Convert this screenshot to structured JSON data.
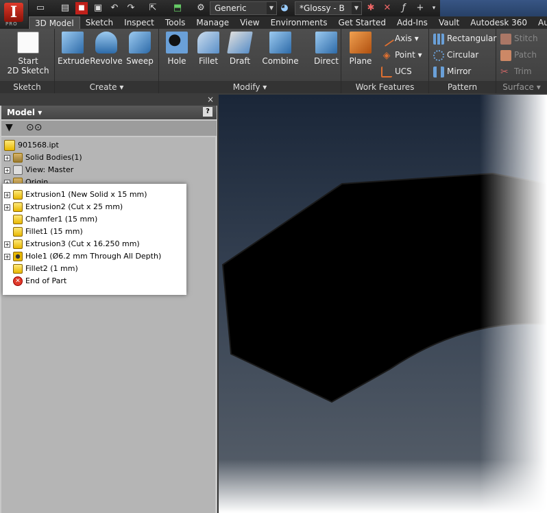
{
  "qat": {
    "material": "Generic",
    "appearance": "*Glossy - B"
  },
  "tabs": [
    "3D Model",
    "Sketch",
    "Inspect",
    "Tools",
    "Manage",
    "View",
    "Environments",
    "Get Started",
    "Add-Ins",
    "Vault",
    "Autodesk 360",
    "Autod"
  ],
  "ribbon": {
    "sketch": {
      "start_line1": "Start",
      "start_line2": "2D Sketch",
      "title": "Sketch"
    },
    "create": {
      "extrude": "Extrude",
      "revolve": "Revolve",
      "sweep": "Sweep",
      "title": "Create ▾"
    },
    "modify": {
      "hole": "Hole",
      "fillet": "Fillet",
      "draft": "Draft",
      "combine": "Combine",
      "direct": "Direct",
      "title": "Modify ▾"
    },
    "work": {
      "plane": "Plane",
      "axis": "Axis",
      "point": "Point",
      "ucs": "UCS",
      "title": "Work Features"
    },
    "pattern": {
      "rectangular": "Rectangular",
      "circular": "Circular",
      "mirror": "Mirror",
      "title": "Pattern"
    },
    "surface": {
      "stitch": "Stitch",
      "patch": "Patch",
      "trim": "Trim",
      "title": "Surface ▾"
    }
  },
  "browser": {
    "title": "Model ▾",
    "help": "?",
    "close": "×",
    "items": [
      {
        "label": "901568.ipt"
      },
      {
        "label": "Solid Bodies(1)"
      },
      {
        "label": "View: Master"
      },
      {
        "label": "Origin"
      },
      {
        "label": "Extrusion1 (New Solid x 15 mm)"
      },
      {
        "label": "Extrusion2 (Cut x 25 mm)"
      },
      {
        "label": "Chamfer1 (15 mm)"
      },
      {
        "label": "Fillet1 (15 mm)"
      },
      {
        "label": "Extrusion3 (Cut x 16.250 mm)"
      },
      {
        "label": "Hole1 (Ø6.2 mm Through All Depth)"
      },
      {
        "label": "Fillet2 (1 mm)"
      },
      {
        "label": "End of Part"
      }
    ]
  }
}
